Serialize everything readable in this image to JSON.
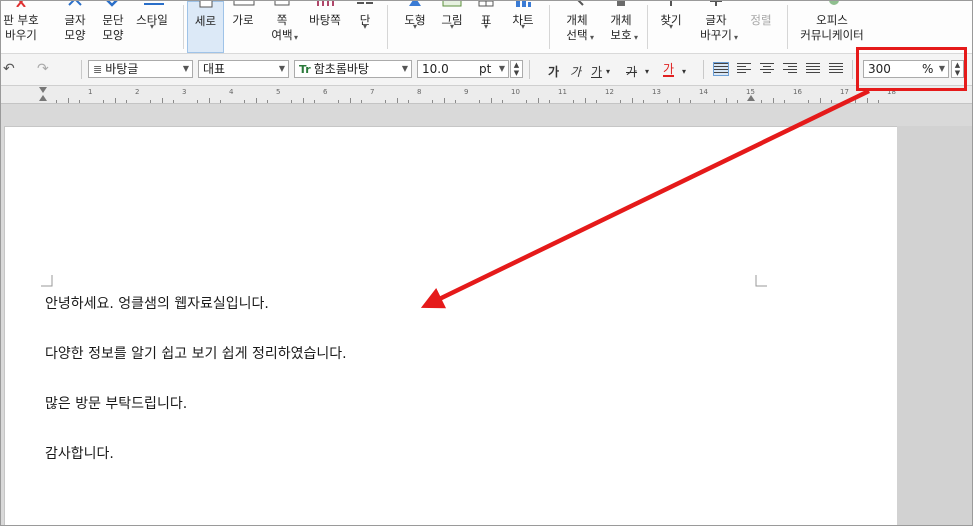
{
  "ribbon": {
    "items": [
      {
        "label": "판 부호\n바우기",
        "icon": "close-icon",
        "color": "#e03030"
      },
      {
        "label": "글자\n모양",
        "icon": "char-shape-icon"
      },
      {
        "label": "문단\n모양",
        "icon": "para-shape-icon"
      },
      {
        "label": "스타일",
        "icon": "style-icon",
        "dropdown": "▾"
      },
      {
        "label": "세로",
        "icon": "portrait-icon",
        "active": true
      },
      {
        "label": "가로",
        "icon": "landscape-icon"
      },
      {
        "label": "쪽\n여백",
        "icon": "margin-icon",
        "dropdown": "▾"
      },
      {
        "label": "바탕쪽",
        "icon": "master-page-icon"
      },
      {
        "label": "단",
        "icon": "columns-icon",
        "dropdown": "▾"
      },
      {
        "label": "도형",
        "icon": "shape-icon",
        "dropdown": "▾"
      },
      {
        "label": "그림",
        "icon": "picture-icon",
        "dropdown": "▾"
      },
      {
        "label": "표",
        "icon": "table-icon",
        "dropdown": "▾"
      },
      {
        "label": "차트",
        "icon": "chart-icon",
        "dropdown": "▾"
      },
      {
        "label": "개체\n선택",
        "icon": "select-object-icon",
        "dropdown": "▾"
      },
      {
        "label": "개체\n보호",
        "icon": "protect-object-icon",
        "dropdown": "▾"
      },
      {
        "label": "찾기",
        "icon": "find-icon",
        "dropdown": "▾"
      },
      {
        "label": "글자\n바꾸기",
        "icon": "replace-icon",
        "dropdown": "▾"
      },
      {
        "label": "정렬",
        "icon": "sort-icon",
        "disabled": true
      },
      {
        "label": "오피스\n커뮤니케이터",
        "icon": "communicator-icon"
      }
    ]
  },
  "format_bar": {
    "style": "바탕글",
    "language": "대표",
    "font": "함초롬바탕",
    "font_prefix": "Tr",
    "size": "10.0",
    "size_unit": "pt",
    "bold": "가",
    "italic": "가",
    "underline": "가",
    "strike": "가",
    "color": "가",
    "zoom": "300",
    "zoom_unit": "%"
  },
  "ruler": {
    "numbers": [
      "1",
      "2",
      "3",
      "4",
      "5",
      "6",
      "7",
      "8",
      "9",
      "10",
      "11",
      "12",
      "13",
      "14",
      "15",
      "16",
      "17",
      "18"
    ]
  },
  "document": {
    "paragraphs": [
      "안녕하세요.  엉클샘의  웹자료실입니다.",
      "다양한  정보를  알기  쉽고  보기  쉽게  정리하였습니다.",
      "많은  방문  부탁드립니다.",
      "감사합니다."
    ]
  },
  "annotation": {
    "highlight_color": "#e51a1a"
  }
}
